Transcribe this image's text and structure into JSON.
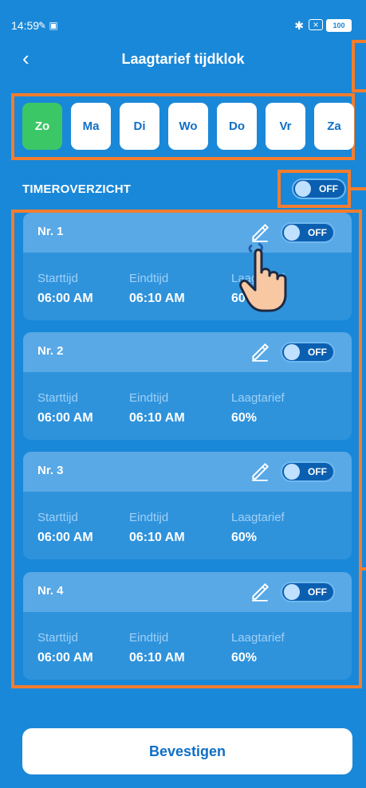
{
  "status": {
    "time": "14:59",
    "battery": "100"
  },
  "header": {
    "title": "Laagtarief tijdklok"
  },
  "days": [
    "Zo",
    "Ma",
    "Di",
    "Wo",
    "Do",
    "Vr",
    "Za"
  ],
  "active_day": "Zo",
  "overview": {
    "label": "TIMEROVERZICHT",
    "toggle": "OFF"
  },
  "timers": [
    {
      "name": "Nr. 1",
      "toggle": "OFF",
      "start_label": "Starttijd",
      "start": "06:00 AM",
      "end_label": "Eindtijd",
      "end": "06:10 AM",
      "rate_label": "Laagtarief",
      "rate": "60%"
    },
    {
      "name": "Nr. 2",
      "toggle": "OFF",
      "start_label": "Starttijd",
      "start": "06:00 AM",
      "end_label": "Eindtijd",
      "end": "06:10 AM",
      "rate_label": "Laagtarief",
      "rate": "60%"
    },
    {
      "name": "Nr. 3",
      "toggle": "OFF",
      "start_label": "Starttijd",
      "start": "06:00 AM",
      "end_label": "Eindtijd",
      "end": "06:10 AM",
      "rate_label": "Laagtarief",
      "rate": "60%"
    },
    {
      "name": "Nr. 4",
      "toggle": "OFF",
      "start_label": "Starttijd",
      "start": "06:00 AM",
      "end_label": "Eindtijd",
      "end": "06:10 AM",
      "rate_label": "Laagtarief",
      "rate": "60%"
    }
  ],
  "confirm_label": "Bevestigen",
  "colors": {
    "background": "#1a88d8",
    "active_day": "#3cc766",
    "annotation": "#f37d2e",
    "card": "#2f93dc",
    "card_header": "#59a9e6"
  },
  "icons": [
    "back-chevron-icon",
    "bluetooth-icon",
    "sim-icon",
    "battery-icon",
    "pencil-edit-icon",
    "tap-hand-icon"
  ]
}
